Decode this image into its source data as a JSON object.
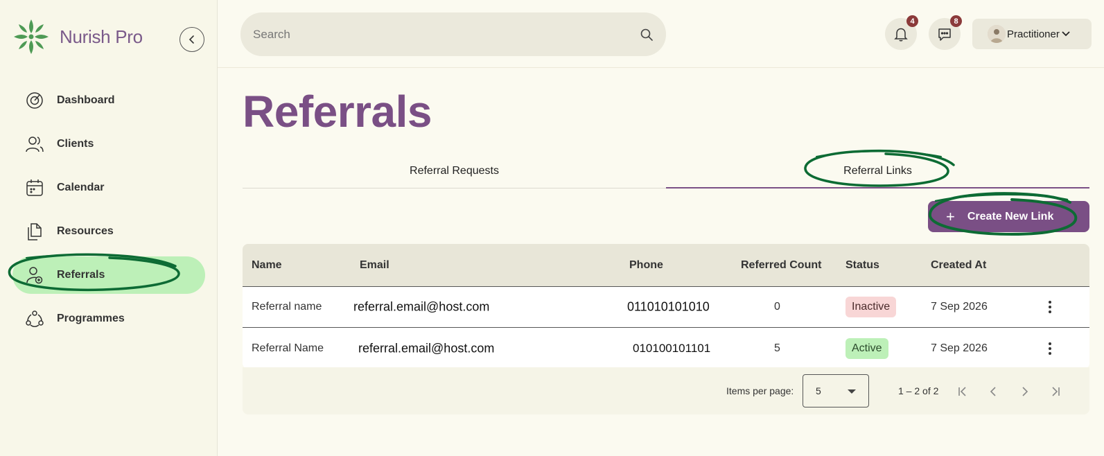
{
  "app": {
    "name": "Nurish Pro"
  },
  "sidebar": {
    "items": [
      {
        "label": "Dashboard",
        "icon": "dashboard-icon",
        "active": false
      },
      {
        "label": "Clients",
        "icon": "users-icon",
        "active": false
      },
      {
        "label": "Calendar",
        "icon": "calendar-icon",
        "active": false
      },
      {
        "label": "Resources",
        "icon": "documents-icon",
        "active": false
      },
      {
        "label": "Referrals",
        "icon": "user-add-icon",
        "active": true
      },
      {
        "label": "Programmes",
        "icon": "network-icon",
        "active": false
      }
    ]
  },
  "header": {
    "search_placeholder": "Search",
    "notifications_count": "4",
    "messages_count": "8",
    "user_name": "Practitioner"
  },
  "page": {
    "title": "Referrals",
    "tabs": [
      {
        "label": "Referral Requests",
        "active": false
      },
      {
        "label": "Referral Links",
        "active": true
      }
    ],
    "create_button": "Create New  Link"
  },
  "table": {
    "columns": [
      "Name",
      "Email",
      "Phone",
      "Referred Count",
      "Status",
      "Created At"
    ],
    "rows": [
      {
        "name": "Referral name",
        "email": "referral.email@host.com",
        "phone": "011010101010",
        "count": "0",
        "status": "Inactive",
        "created": "7 Sep 2026"
      },
      {
        "name": "Referral Name",
        "email": "referral.email@host.com",
        "phone": "010100101101",
        "count": "5",
        "status": "Active",
        "created": "7 Sep 2026"
      }
    ]
  },
  "paginator": {
    "items_label": "Items per page:",
    "page_size": "5",
    "range": "1 – 2 of 2"
  },
  "colors": {
    "brand_purple": "#7a4f85",
    "active_green": "#bdf0b8",
    "annotation_green": "#0d6b34",
    "inactive_red": "#f8d6d6"
  }
}
